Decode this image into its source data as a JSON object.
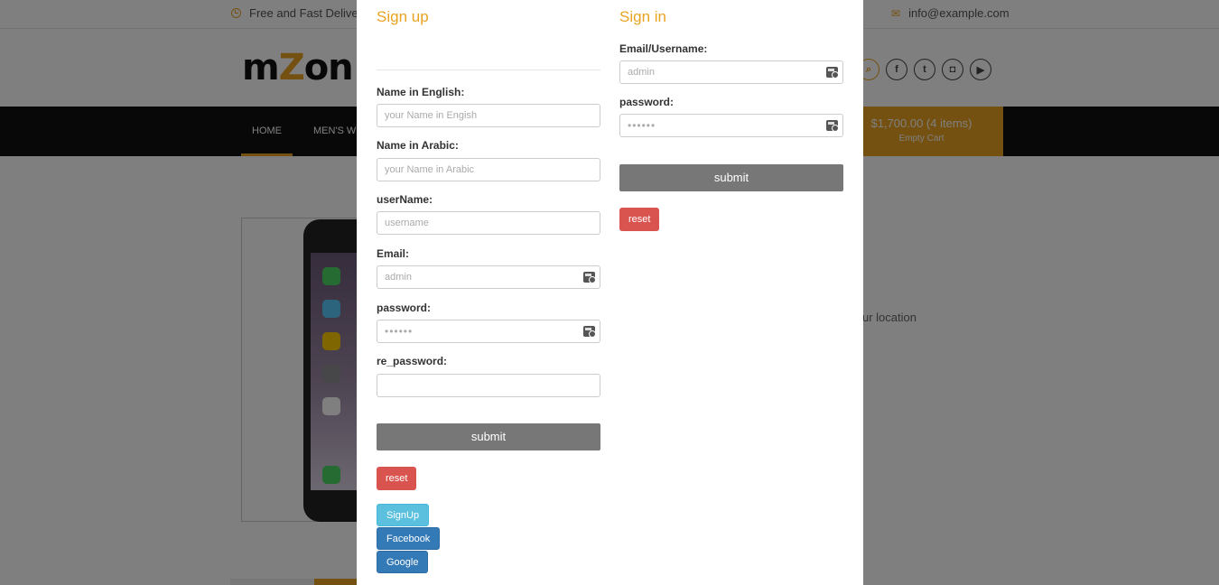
{
  "topbar": {
    "delivery_text": "Free and Fast Delivery",
    "email_text": "info@example.com",
    "delivery_icon": "clock-icon",
    "email_icon": "mail-icon"
  },
  "header": {
    "logo_prefix": "m",
    "logo_highlight": "Z",
    "logo_suffix": "on",
    "socials": [
      "search-icon",
      "facebook-icon",
      "twitter-icon",
      "instagram-icon",
      "youtube-icon"
    ]
  },
  "nav": {
    "home": "HOME",
    "mens": "MEN'S W"
  },
  "cart": {
    "total": "$1,700.00 (4 items)",
    "empty": "Empty Cart"
  },
  "product": {
    "location_text": "ur location"
  },
  "modal": {
    "signup": {
      "title": "Sign up",
      "name_en_label": "Name in English:",
      "name_en_placeholder": "your Name in Engish",
      "name_ar_label": "Name in Arabic:",
      "name_ar_placeholder": "your Name in Arabic",
      "username_label": "userName:",
      "username_placeholder": "username",
      "email_label": "Email:",
      "email_placeholder": "admin",
      "password_label": "password:",
      "password_placeholder": "••••••",
      "repassword_label": "re_password:",
      "submit_label": "submit",
      "reset_label": "reset",
      "signup_button": "SignUp",
      "facebook_button": "Facebook",
      "google_button": "Google"
    },
    "signin": {
      "title": "Sign in",
      "email_label": "Email/Username:",
      "email_placeholder": "admin",
      "password_label": "password:",
      "password_placeholder": "••••••",
      "submit_label": "submit",
      "reset_label": "reset"
    }
  },
  "colors": {
    "accent": "#e8a320",
    "reset": "#d9534f",
    "signup": "#5bc0de",
    "social": "#337ab7",
    "submit": "#777777"
  }
}
